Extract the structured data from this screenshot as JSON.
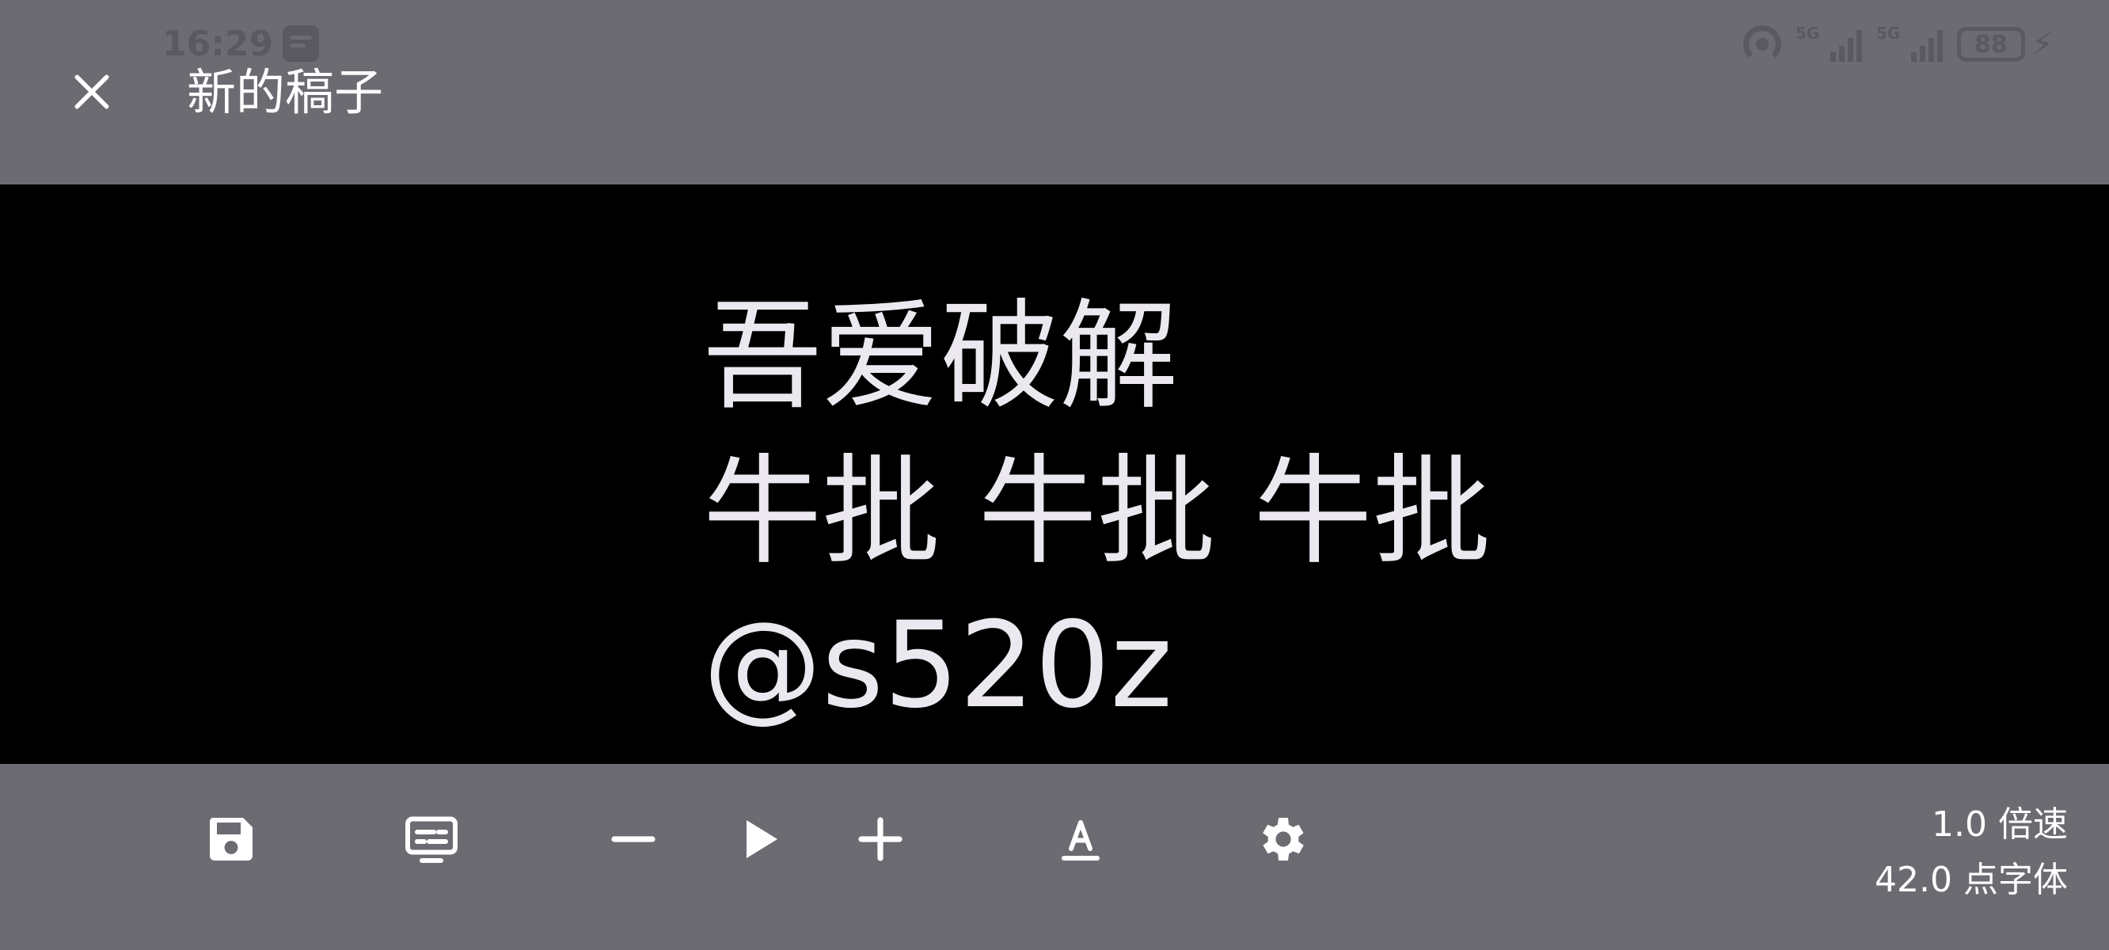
{
  "status_bar": {
    "time": "16:29",
    "signal1_label": "5G",
    "signal2_label": "5G",
    "battery_level": "88",
    "icons": [
      "notification-icon",
      "hotspot-icon",
      "signal-icon",
      "signal-icon",
      "battery-icon",
      "charging-icon"
    ]
  },
  "header": {
    "title": "新的稿子",
    "close_icon": "close-icon"
  },
  "script": {
    "lines": [
      "吾爱破解",
      "牛批 牛批 牛批",
      "@s520z"
    ]
  },
  "toolbar": {
    "items": [
      {
        "name": "save-button",
        "icon": "save-icon"
      },
      {
        "name": "subtitle-button",
        "icon": "subtitles-icon"
      },
      {
        "name": "decrease-speed-button",
        "icon": "minus-icon"
      },
      {
        "name": "play-button",
        "icon": "play-icon"
      },
      {
        "name": "increase-speed-button",
        "icon": "plus-icon"
      },
      {
        "name": "font-button",
        "icon": "text-format-icon"
      },
      {
        "name": "settings-button",
        "icon": "gear-icon"
      }
    ],
    "speed_text": "1.0 倍速",
    "font_size_text": "42.0 点字体"
  },
  "colors": {
    "bar_background": "#6d6b72",
    "prompter_background": "#000000",
    "text": "#ebe9ef"
  }
}
